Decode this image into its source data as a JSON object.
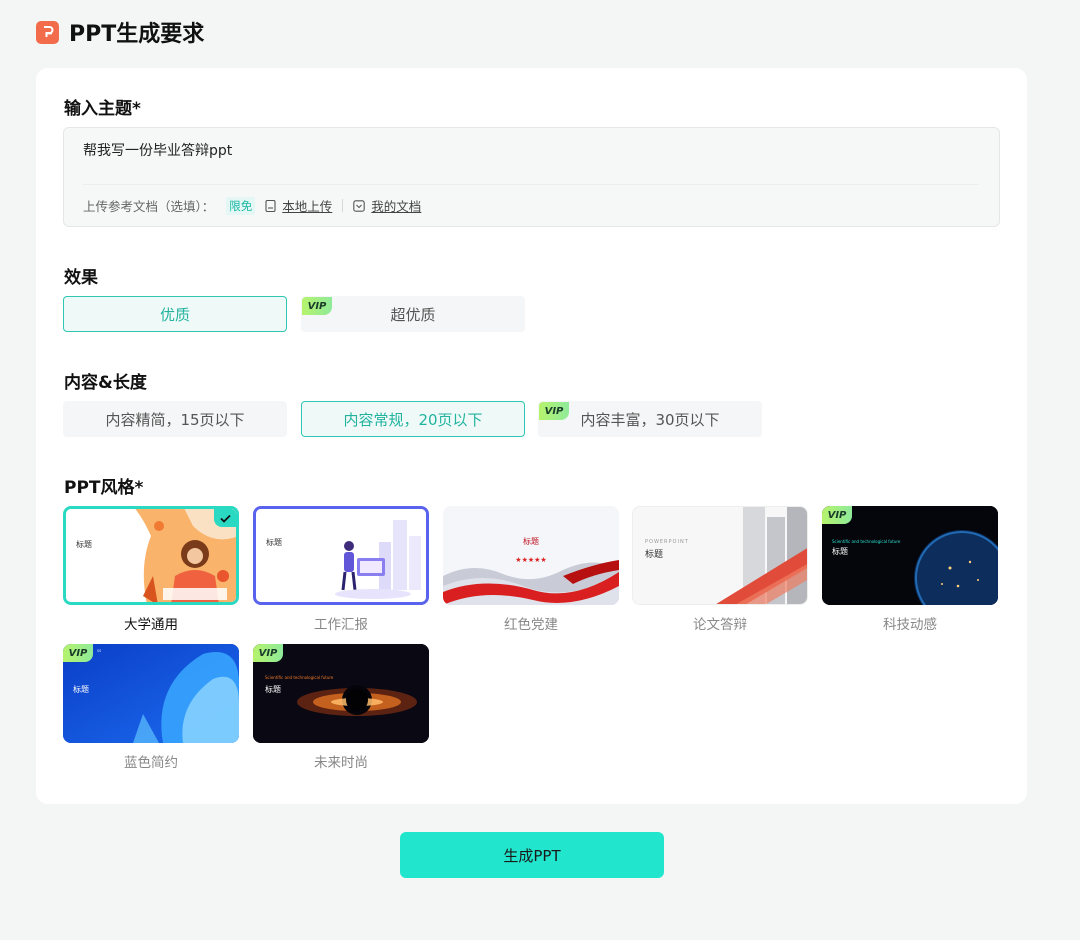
{
  "header": {
    "title": "PPT生成要求",
    "logo_icon": "ppt-logo-icon"
  },
  "topic": {
    "label": "输入主题*",
    "value": "帮我写一份毕业答辩ppt",
    "upload_prefix": "上传参考文档（选填）：",
    "free_badge": "限免",
    "local_upload": "本地上传",
    "my_docs": "我的文档"
  },
  "effect": {
    "label": "效果",
    "options": [
      {
        "label": "优质",
        "selected": true,
        "vip": false
      },
      {
        "label": "超优质",
        "selected": false,
        "vip": true
      }
    ]
  },
  "length": {
    "label": "内容&长度",
    "options": [
      {
        "label": "内容精简，15页以下",
        "selected": false,
        "vip": false
      },
      {
        "label": "内容常规，20页以下",
        "selected": true,
        "vip": false
      },
      {
        "label": "内容丰富，30页以下",
        "selected": false,
        "vip": true
      }
    ]
  },
  "style": {
    "label": "PPT风格*",
    "vip_text": "VIP",
    "items": [
      {
        "name": "大学通用",
        "thumb_title": "标题",
        "selected": true,
        "vip": false
      },
      {
        "name": "工作汇报",
        "thumb_title": "标题",
        "selected": false,
        "vip": false
      },
      {
        "name": "红色党建",
        "thumb_title": "标题",
        "selected": false,
        "vip": false
      },
      {
        "name": "论文答辩",
        "thumb_title": "标题",
        "thumb_subtitle": "POWERPOINT",
        "selected": false,
        "vip": false
      },
      {
        "name": "科技动感",
        "thumb_title": "标题",
        "thumb_subtitle": "Scientific and technological future",
        "selected": false,
        "vip": true
      },
      {
        "name": "蓝色简约",
        "thumb_title": "标题",
        "thumb_subtitle": "ss",
        "selected": false,
        "vip": true
      },
      {
        "name": "未来时尚",
        "thumb_title": "标题",
        "thumb_subtitle": "Scientific and technological future",
        "selected": false,
        "vip": true
      }
    ]
  },
  "generate_button": "生成PPT",
  "colors": {
    "accent": "#21e6cd",
    "selected_border": "#2ec7b3",
    "logo": "#f26b4b"
  }
}
